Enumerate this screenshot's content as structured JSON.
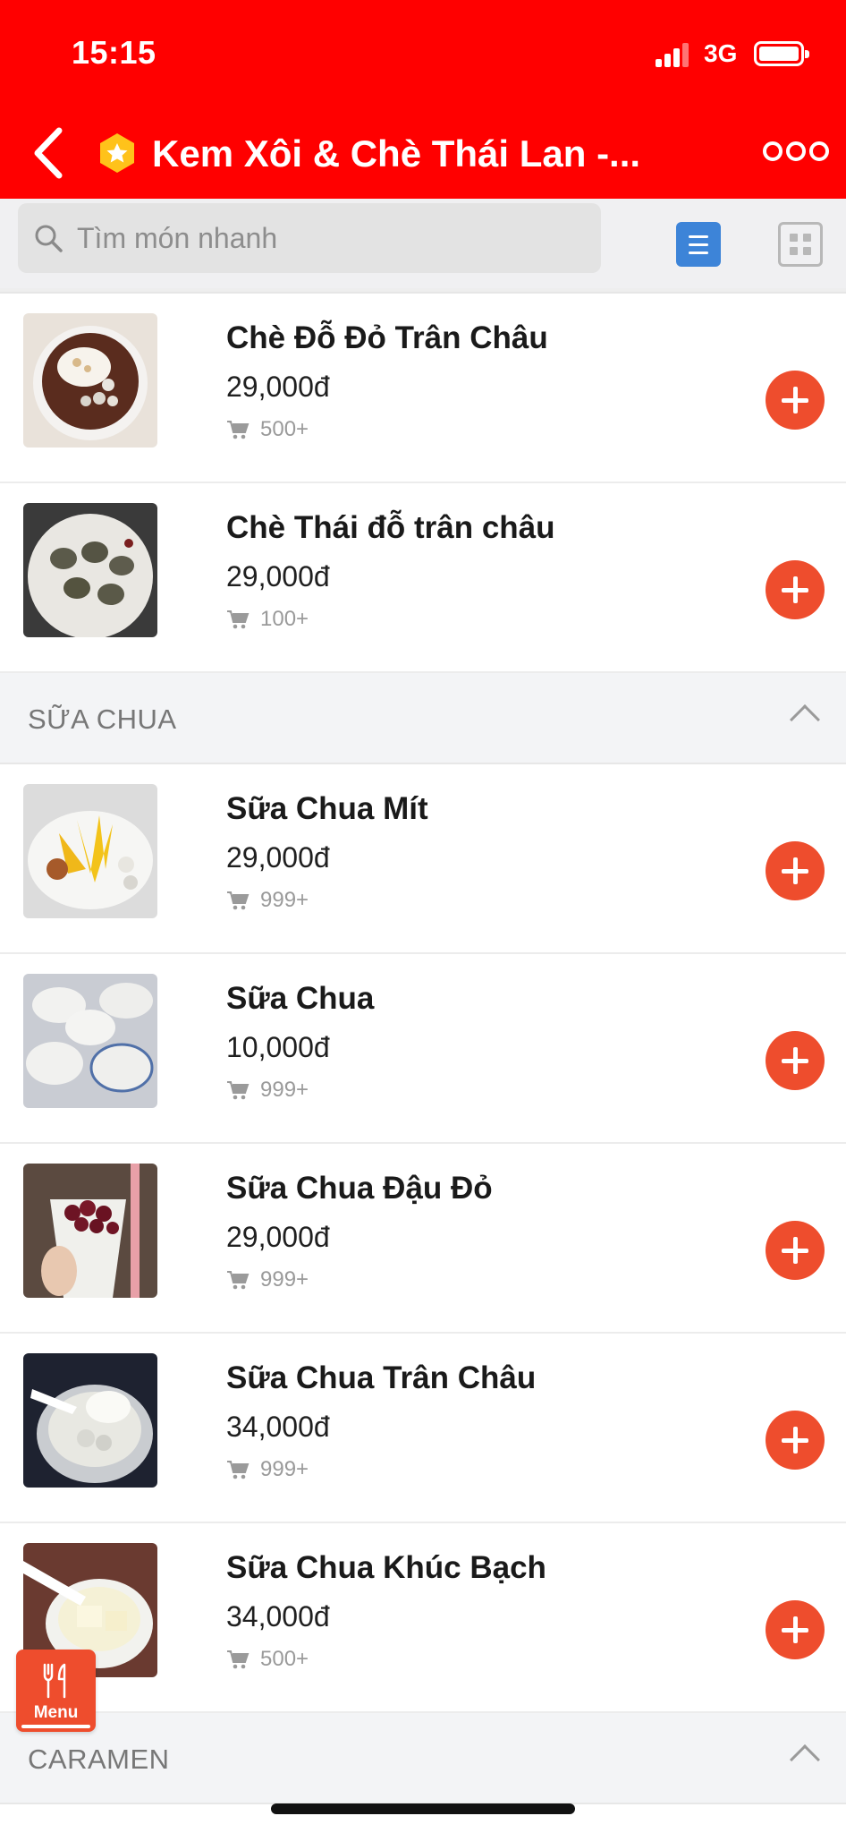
{
  "status_bar": {
    "time": "15:15",
    "network": "3G"
  },
  "header": {
    "title": "Kem Xôi & Chè Thái Lan -..."
  },
  "search": {
    "placeholder": "Tìm món nhanh"
  },
  "sections": [
    {
      "items": [
        {
          "name": "Chè Đỗ Đỏ Trân Châu",
          "price": "29,000đ",
          "sold": "500+"
        },
        {
          "name": "Chè Thái đỗ trân châu",
          "price": "29,000đ",
          "sold": "100+"
        }
      ]
    },
    {
      "title": "SỮA CHUA",
      "items": [
        {
          "name": "Sữa Chua Mít",
          "price": "29,000đ",
          "sold": "999+"
        },
        {
          "name": "Sữa Chua",
          "price": "10,000đ",
          "sold": "999+"
        },
        {
          "name": "Sữa Chua Đậu Đỏ",
          "price": "29,000đ",
          "sold": "999+"
        },
        {
          "name": "Sữa Chua Trân Châu",
          "price": "34,000đ",
          "sold": "999+"
        },
        {
          "name": "Sữa Chua Khúc Bạch",
          "price": "34,000đ",
          "sold": "500+"
        }
      ]
    },
    {
      "title": "CARAMEN"
    }
  ],
  "menu_fab": {
    "label": "Menu"
  },
  "colors": {
    "header": "#ff0000",
    "accent": "#ee4d2d",
    "list_view_active": "#3d84d8"
  }
}
